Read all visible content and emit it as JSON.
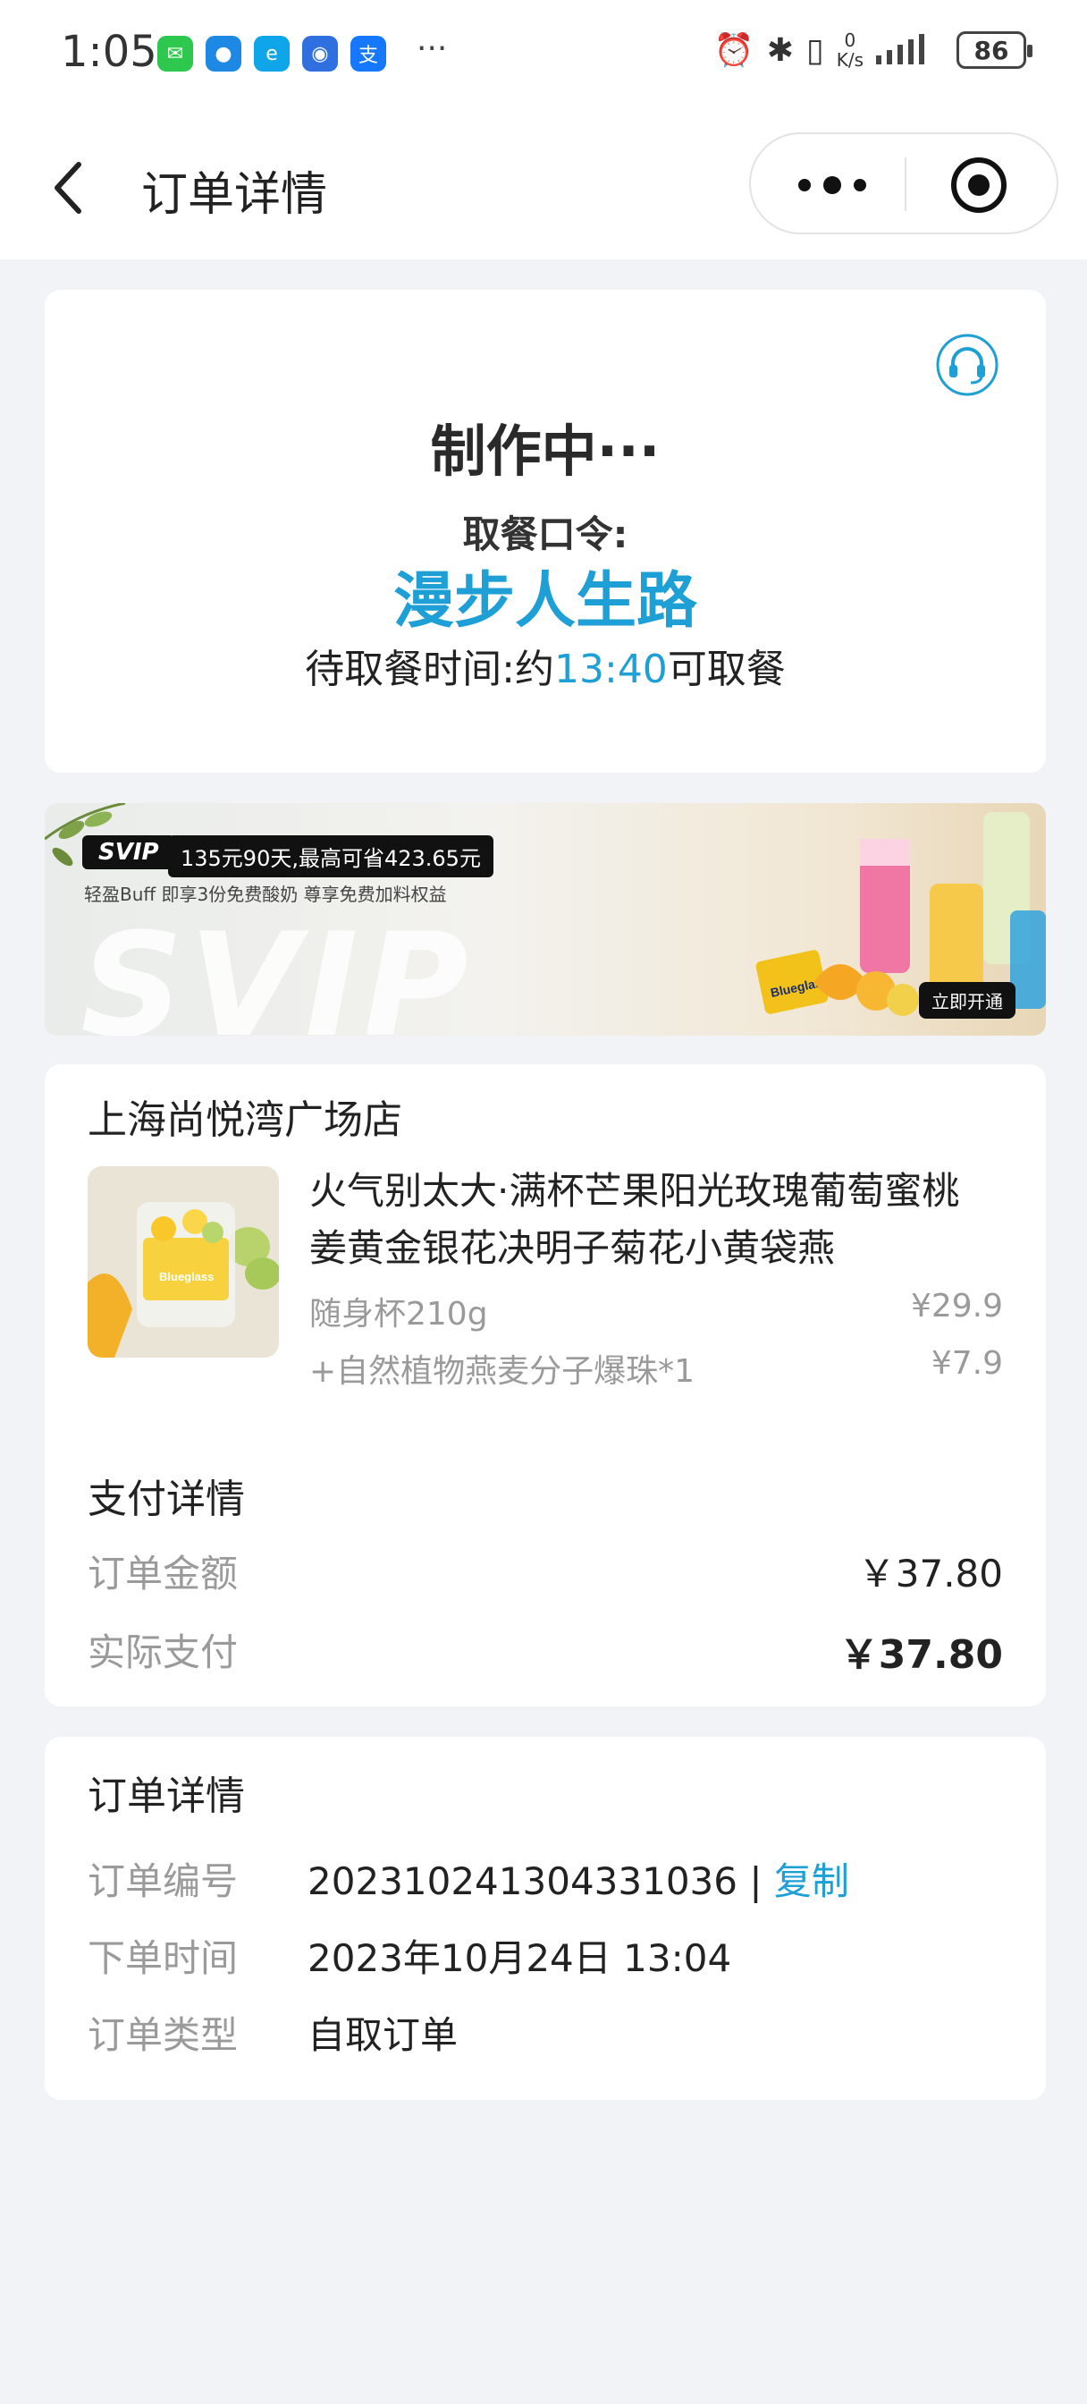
{
  "status_bar": {
    "time": "1:05",
    "more": "···",
    "netspeed_value": "0",
    "netspeed_unit": "K/s",
    "battery": "86",
    "app_icons": [
      {
        "name": "wechat-icon",
        "color": "#2dc84d",
        "glyph": "✉"
      },
      {
        "name": "messages-icon",
        "color": "#1e88e5",
        "glyph": "●"
      },
      {
        "name": "ele-me-icon",
        "color": "#0ea5e9",
        "glyph": "e"
      },
      {
        "name": "browser-icon",
        "color": "#2f6fe0",
        "glyph": "◉"
      },
      {
        "name": "alipay-icon",
        "color": "#1677ff",
        "glyph": "支"
      }
    ]
  },
  "nav": {
    "title": "订单详情"
  },
  "status_card": {
    "status": "制作中···",
    "code_label": "取餐口令:",
    "code_value": "漫步人生路",
    "pickup_prefix": "待取餐时间:约",
    "pickup_time": "13:40",
    "pickup_suffix": "可取餐"
  },
  "banner": {
    "badge": "SVIP",
    "offer": "135元90天,最高可省423.65元",
    "benefits": "轻盈Buff   即享3份免费酸奶  尊享免费加料权益",
    "watermark": "SVIP",
    "brand": "Blueglass",
    "button": "立即开通"
  },
  "order": {
    "store": "上海尚悦湾广场店",
    "product_name": "火气别太大·满杯芒果阳光玫瑰葡萄蜜桃姜黄金银花决明子菊花小黄袋燕",
    "items": [
      {
        "label": "随身杯210g",
        "price": "¥29.9"
      },
      {
        "label": "+自然植物燕麦分子爆珠*1",
        "price": "¥7.9"
      }
    ],
    "pay_title": "支付详情",
    "order_amount_label": "订单金额",
    "order_amount": "￥37.80",
    "paid_label": "实际支付",
    "paid_amount": "￥37.80"
  },
  "details": {
    "title": "订单详情",
    "number_label": "订单编号",
    "number": "202310241304331036 | ",
    "copy": "复制",
    "time_label": "下单时间",
    "time": "2023年10月24日 13:04",
    "type_label": "订单类型",
    "type": "自取订单"
  },
  "colors": {
    "accent": "#1e9fd6",
    "background": "#f2f3f7",
    "muted_text": "#9a9a9a"
  }
}
